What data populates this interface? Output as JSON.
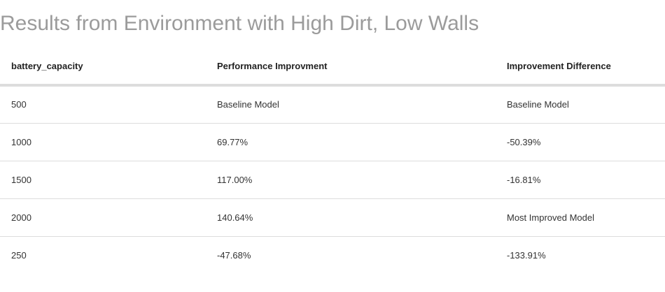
{
  "title": "Results from Environment with High Dirt, Low Walls",
  "table": {
    "headers": [
      "battery_capacity",
      "Performance Improvment",
      "Improvement Difference"
    ],
    "rows": [
      [
        "500",
        "Baseline Model",
        "Baseline Model"
      ],
      [
        "1000",
        "69.77%",
        "-50.39%"
      ],
      [
        "1500",
        "117.00%",
        "-16.81%"
      ],
      [
        "2000",
        "140.64%",
        "Most Improved Model"
      ],
      [
        "250",
        "-47.68%",
        "-133.91%"
      ]
    ]
  }
}
